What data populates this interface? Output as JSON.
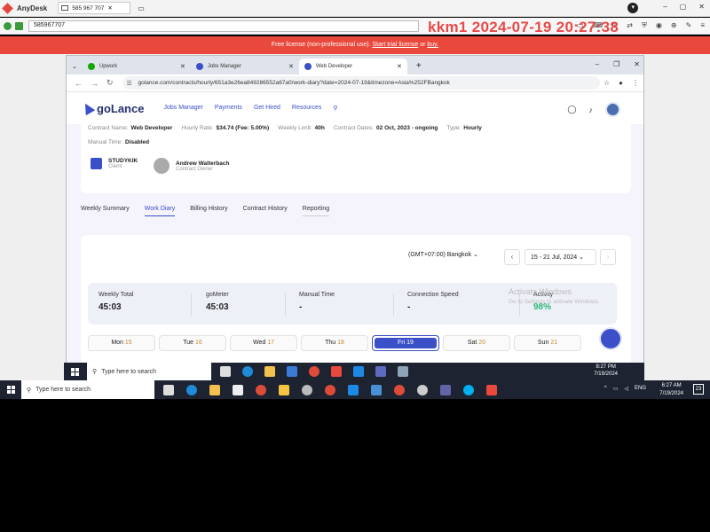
{
  "anydesk": {
    "app_title": "AnyDesk",
    "session_tab": "585 967 707",
    "address_value": "585967707",
    "watermark": "kkm1 2024-07-19 20:27:38"
  },
  "license_bar": {
    "text": "Free license (non-professional use).",
    "link1": "Start trial license",
    "or": "or",
    "link2": "buy."
  },
  "browser": {
    "tabs": [
      {
        "label": "Upwork"
      },
      {
        "label": "Jobs Manager"
      },
      {
        "label": "Web Developer"
      }
    ],
    "url": "golance.com/contracts/hourly/651a3e26ea849286552a67a0/work-diary?date=2024-07-19&timezone=Asia%252FBangkok"
  },
  "header": {
    "logo": "goLance",
    "nav": [
      "Jobs Manager",
      "Payments",
      "Get Hired",
      "Resources"
    ]
  },
  "contract": {
    "name_label": "Contract Name:",
    "name_value": "Web Developer",
    "rate_label": "Hourly Rate:",
    "rate_value": "$34.74 (Fee: 5.00%)",
    "limit_label": "Weekly Limit:",
    "limit_value": "40h",
    "dates_label": "Contract Dates:",
    "dates_value": "02 Oct, 2023 - ongoing",
    "type_label": "Type:",
    "type_value": "Hourly",
    "manual_label": "Manual Time:",
    "manual_value": "Disabled",
    "client_name": "STUDYKIK",
    "client_role": "Client",
    "owner_name": "Andrew Walterbach",
    "owner_role": "Contract Owner"
  },
  "subtabs": [
    "Weekly Summary",
    "Work Diary",
    "Billing History",
    "Contract History",
    "Reporting"
  ],
  "diary": {
    "timezone": "(GMT+07:00) Bangkok",
    "week": "15 - 21 Jul, 2024",
    "stats": [
      {
        "label": "Weekly Total",
        "value": "45:03"
      },
      {
        "label": "goMeter",
        "value": "45:03"
      },
      {
        "label": "Manual Time",
        "value": "-"
      },
      {
        "label": "Connection Speed",
        "value": "-"
      },
      {
        "label": "Activity",
        "value": "98%"
      }
    ],
    "days": [
      {
        "name": "Mon",
        "num": "15"
      },
      {
        "name": "Tue",
        "num": "16"
      },
      {
        "name": "Wed",
        "num": "17"
      },
      {
        "name": "Thu",
        "num": "18"
      },
      {
        "name": "Fri",
        "num": "19"
      },
      {
        "name": "Sat",
        "num": "20"
      },
      {
        "name": "Sun",
        "num": "21"
      }
    ]
  },
  "activate": {
    "line1": "Activate Windows",
    "line2": "Go to Settings to activate Windows."
  },
  "remote_taskbar": {
    "search": "Type here to search",
    "time": "8:27 PM",
    "date": "7/19/2024"
  },
  "local_taskbar": {
    "search": "Type here to search",
    "lang": "ENG",
    "time": "6:27 AM",
    "date": "7/19/2024",
    "notif_count": "23"
  },
  "colors": {
    "brand": "#3a4fc8",
    "license_bar": "#e9483c",
    "activity_green": "#2bb673",
    "taskbar": "#1d2330"
  }
}
